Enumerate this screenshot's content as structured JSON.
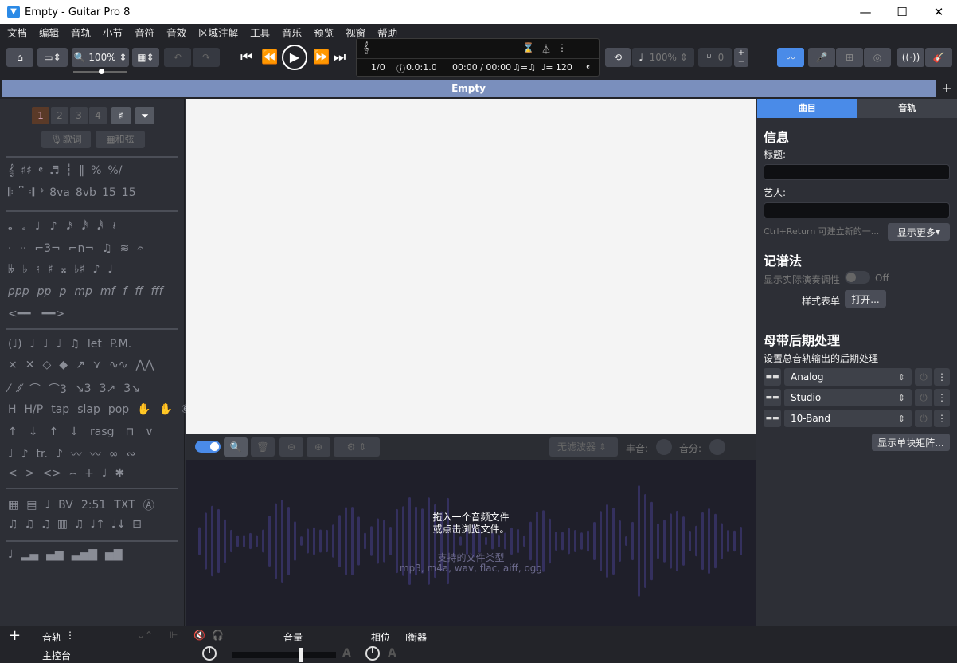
{
  "window": {
    "title": "Empty - Guitar Pro 8",
    "app_icon": "guitar-pick-icon"
  },
  "menu": [
    "文档",
    "编辑",
    "音轨",
    "小节",
    "音符",
    "音效",
    "区域注解",
    "工具",
    "音乐",
    "预览",
    "视窗",
    "帮助"
  ],
  "toolbar": {
    "zoom": "100%",
    "speed": "100%",
    "pitch": "0",
    "lcd": {
      "bar": "1/0",
      "signature": "0.0:1.0",
      "time": "00:00 / 00:00",
      "triplet": "♫=♫",
      "tempo": "♩= 120"
    }
  },
  "tab": {
    "title": "Empty",
    "add": "+"
  },
  "left": {
    "voices": [
      "1",
      "2",
      "3",
      "4"
    ],
    "lyrics": "歌词",
    "chords": "和弦"
  },
  "audio": {
    "filter": "无滤波器",
    "loudness_label": "丰音:",
    "pan_label": "音分:",
    "drop_line1": "拖入一个音频文件",
    "drop_line2": "或点击浏览文件。",
    "types_title": "支持的文件类型",
    "types": "mp3, m4a, wav, flac, aiff, ogg"
  },
  "right": {
    "tabs": [
      "曲目",
      "音轨"
    ],
    "info_title": "信息",
    "title_label": "标题:",
    "artist_label": "艺人:",
    "hint": "Ctrl+Return 可建立新的一...",
    "show_more": "显示更多",
    "notation_title": "记谱法",
    "transpose_label": "显示实际演奏调性",
    "transpose_state": "Off",
    "stylesheet_label": "样式表单",
    "stylesheet_btn": "打开...",
    "master_title": "母带后期处理",
    "master_desc": "设置总音轨输出的后期处理",
    "effects": [
      "Analog",
      "Studio",
      "10-Band"
    ],
    "matrix_btn": "显示单块矩阵..."
  },
  "bottom": {
    "add": "+",
    "track_label": "音轨",
    "master_label": "主控台",
    "volume_label": "音量",
    "phase_label": "相位",
    "balance_label": "均衡器"
  }
}
